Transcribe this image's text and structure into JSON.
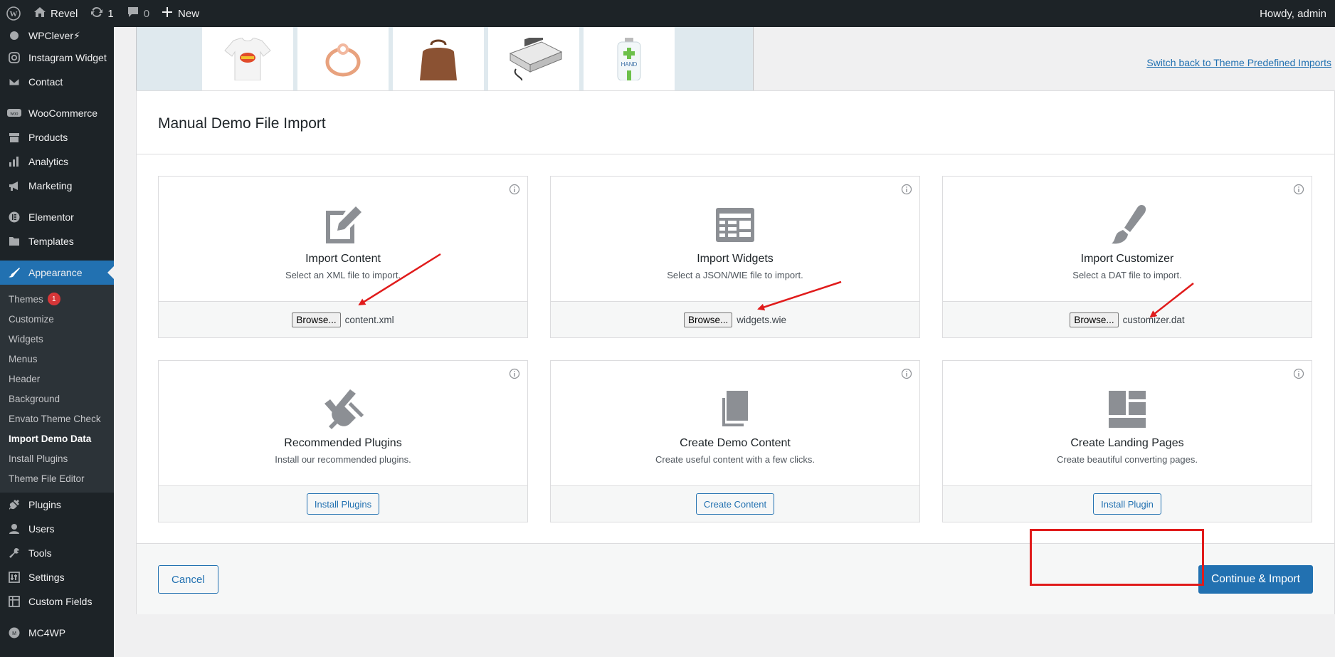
{
  "adminbar": {
    "site_name": "Revel",
    "updates_count": "1",
    "comments_count": "0",
    "new_label": "New",
    "howdy": "Howdy, admin"
  },
  "sidebar": {
    "items_top": [
      {
        "label": "WPClever⚡",
        "icon": "wpclever-icon"
      },
      {
        "label": "Instagram Widget",
        "icon": "instagram-icon"
      },
      {
        "label": "Contact",
        "icon": "mail-icon"
      },
      {
        "label": "WooCommerce",
        "icon": "woocommerce-icon"
      },
      {
        "label": "Products",
        "icon": "archive-icon"
      },
      {
        "label": "Analytics",
        "icon": "chart-bar-icon"
      },
      {
        "label": "Marketing",
        "icon": "megaphone-icon"
      },
      {
        "label": "Elementor",
        "icon": "elementor-icon"
      },
      {
        "label": "Templates",
        "icon": "folder-icon"
      }
    ],
    "active_item": {
      "label": "Appearance",
      "icon": "paintbrush-icon"
    },
    "submenu": [
      {
        "label": "Themes",
        "badge": "1"
      },
      {
        "label": "Customize"
      },
      {
        "label": "Widgets"
      },
      {
        "label": "Menus"
      },
      {
        "label": "Header"
      },
      {
        "label": "Background"
      },
      {
        "label": "Envato Theme Check"
      },
      {
        "label": "Import Demo Data"
      },
      {
        "label": "Install Plugins"
      },
      {
        "label": "Theme File Editor"
      }
    ],
    "items_bottom": [
      {
        "label": "Plugins",
        "icon": "plug-icon"
      },
      {
        "label": "Users",
        "icon": "user-icon"
      },
      {
        "label": "Tools",
        "icon": "wrench-icon"
      },
      {
        "label": "Settings",
        "icon": "settings-icon"
      },
      {
        "label": "Custom Fields",
        "icon": "table-icon"
      },
      {
        "label": "MC4WP",
        "icon": "mc4wp-icon"
      }
    ]
  },
  "switch_link": "Switch back to Theme Predefined Imports",
  "panel_title": "Manual Demo File Import",
  "cards": [
    {
      "title": "Import Content",
      "desc": "Select an XML file to import.",
      "browse": "Browse...",
      "file": "content.xml",
      "icon": "edit-page-icon"
    },
    {
      "title": "Import Widgets",
      "desc": "Select a JSON/WIE file to import.",
      "browse": "Browse...",
      "file": "widgets.wie",
      "icon": "widgets-icon"
    },
    {
      "title": "Import Customizer",
      "desc": "Select a DAT file to import.",
      "browse": "Browse...",
      "file": "customizer.dat",
      "icon": "brush-icon"
    },
    {
      "title": "Recommended Plugins",
      "desc": "Install our recommended plugins.",
      "button": "Install Plugins",
      "icon": "plugin-check-icon"
    },
    {
      "title": "Create Demo Content",
      "desc": "Create useful content with a few clicks.",
      "button": "Create Content",
      "icon": "pages-icon"
    },
    {
      "title": "Create Landing Pages",
      "desc": "Create beautiful converting pages.",
      "button": "Install Plugin",
      "icon": "layout-icon"
    }
  ],
  "footer": {
    "cancel": "Cancel",
    "continue": "Continue & Import"
  },
  "colors": {
    "wp_blue": "#2271b1",
    "admin_dark": "#1d2327",
    "annotation_red": "#e01b1b"
  }
}
